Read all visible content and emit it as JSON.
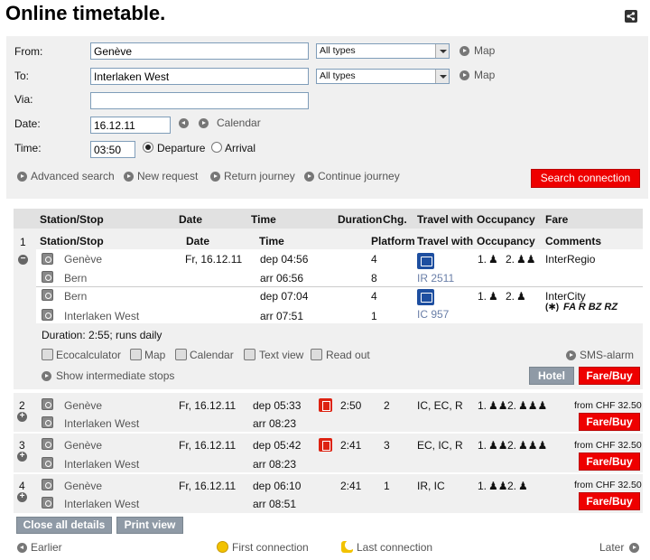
{
  "page": {
    "title": "Online timetable."
  },
  "form": {
    "from_label": "From:",
    "from_value": "Genève",
    "from_type": "All types",
    "to_label": "To:",
    "to_value": "Interlaken West",
    "to_type": "All types",
    "via_label": "Via:",
    "via_value": "",
    "date_label": "Date:",
    "date_value": "16.12.11",
    "calendar_label": "Calendar",
    "time_label": "Time:",
    "time_value": "03:50",
    "departure_label": "Departure",
    "arrival_label": "Arrival",
    "map_label": "Map",
    "advanced_search": "Advanced search",
    "new_request": "New request",
    "return_journey": "Return journey",
    "continue_journey": "Continue journey",
    "search_button": "Search connection"
  },
  "results": {
    "headers": {
      "station": "Station/Stop",
      "date": "Date",
      "time": "Time",
      "duration": "Duration",
      "changes": "Chg.",
      "travel_with": "Travel with",
      "occupancy": "Occupancy",
      "fare": "Fare"
    },
    "detail": {
      "number": "1",
      "subheaders": {
        "station": "Station/Stop",
        "date": "Date",
        "time": "Time",
        "platform": "Platform",
        "travel_with": "Travel with",
        "occupancy": "Occupancy",
        "comments": "Comments"
      },
      "legs": [
        {
          "from_station": "Genève",
          "from_date": "Fr, 16.12.11",
          "dep": "dep 04:56",
          "from_platform": "4",
          "to_station": "Bern",
          "arr": "arr  06:56",
          "to_platform": "8",
          "train": "IR 2511",
          "occ1": "1.",
          "occ2": "2.",
          "comment": "InterRegio",
          "extras": ""
        },
        {
          "from_station": "Bern",
          "from_date": "",
          "dep": "dep 07:04",
          "from_platform": "4",
          "to_station": "Interlaken West",
          "arr": "arr  07:51",
          "to_platform": "1",
          "train": "IC 957",
          "occ1": "1.",
          "occ2": "2.",
          "comment": "InterCity",
          "extras": "FA   R  BZ RZ"
        }
      ],
      "duration_note": "Duration: 2:55; runs daily",
      "tools": {
        "eco": "Ecocalculator",
        "map": "Map",
        "calendar": "Calendar",
        "text": "Text view",
        "read": "Read out"
      },
      "sms_alarm": "SMS-alarm",
      "intermediate": "Show intermediate stops",
      "hotel": "Hotel",
      "fare_buy": "Fare/Buy"
    },
    "rows": [
      {
        "number": "2",
        "from": "Genève",
        "to": "Interlaken West",
        "date": "Fr, 16.12.11",
        "dep": "dep  05:33",
        "arr": "arr  08:23",
        "duration": "2:50",
        "changes": "2",
        "products": "IC, EC, R",
        "occ1": "1.",
        "occ2": "2.",
        "fare": "from CHF 32.50",
        "buy": "Fare/Buy"
      },
      {
        "number": "3",
        "from": "Genève",
        "to": "Interlaken West",
        "date": "Fr, 16.12.11",
        "dep": "dep  05:42",
        "arr": "arr  08:23",
        "duration": "2:41",
        "changes": "3",
        "products": "EC, IC, R",
        "occ1": "1.",
        "occ2": "2.",
        "fare": "from CHF 32.50",
        "buy": "Fare/Buy"
      },
      {
        "number": "4",
        "from": "Genève",
        "to": "Interlaken West",
        "date": "Fr, 16.12.11",
        "dep": "dep  06:10",
        "arr": "arr  08:51",
        "duration": "2:41",
        "changes": "1",
        "products": "IR, IC",
        "occ1": "1.",
        "occ2": "2.",
        "fare": "from CHF 32.50",
        "buy": "Fare/Buy"
      }
    ],
    "close_all": "Close all details",
    "print_view": "Print view",
    "earlier": "Earlier",
    "first_connection": "First connection",
    "last_connection": "Last connection",
    "later": "Later"
  },
  "colors": {
    "accent_red": "#e00000",
    "train_blue": "#1e4fa0",
    "panel_gray": "#f0f0f0"
  }
}
